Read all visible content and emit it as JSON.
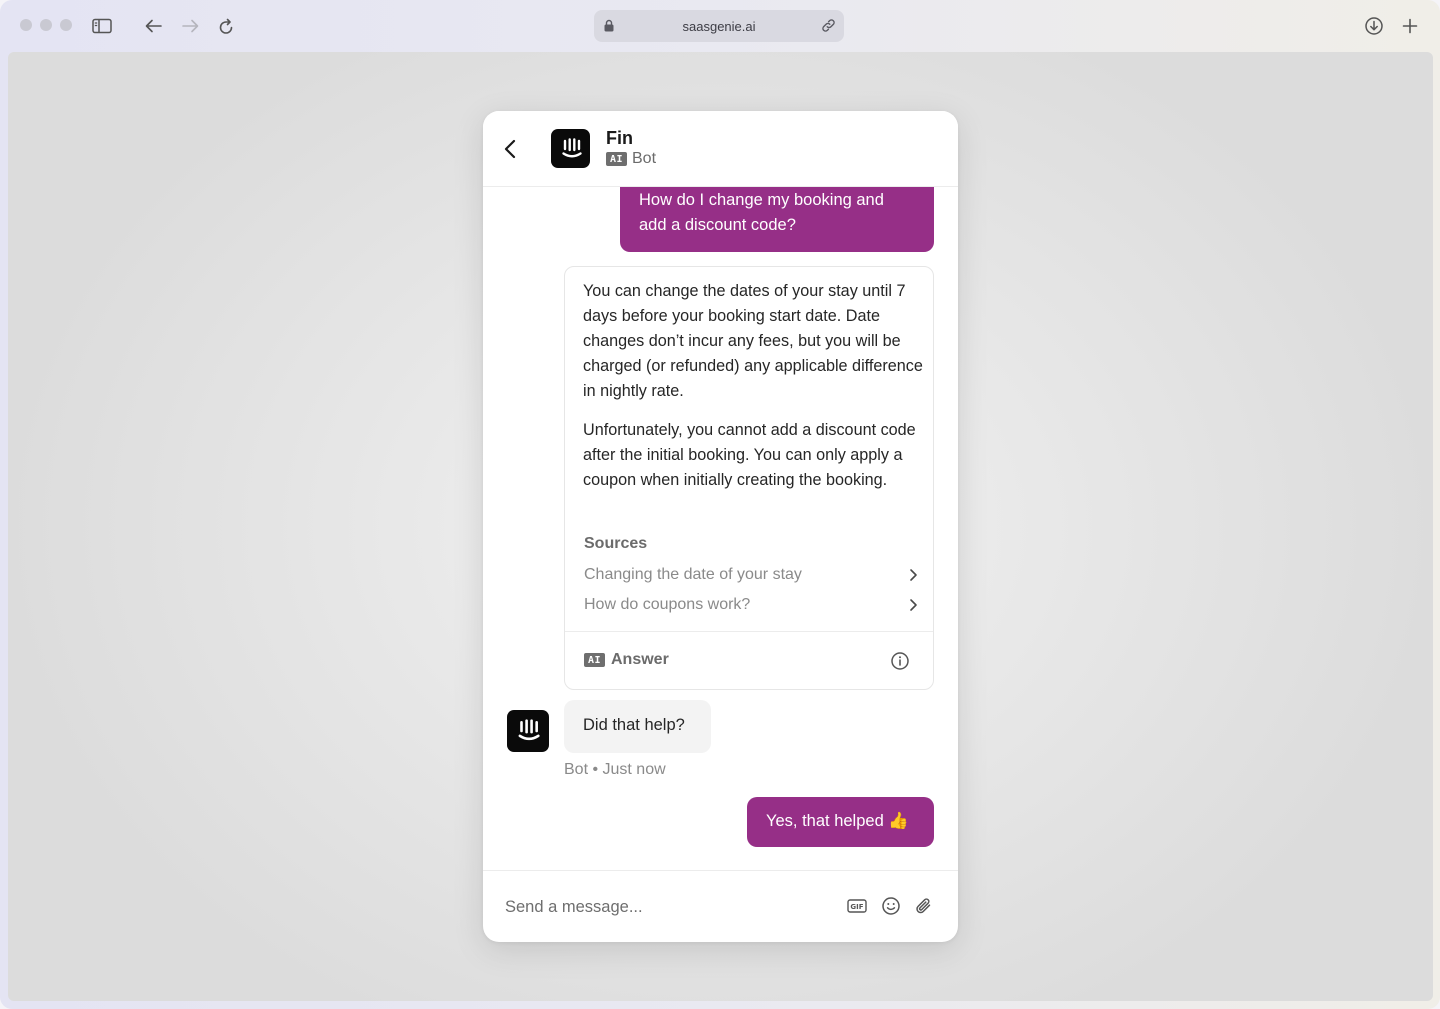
{
  "browser": {
    "url": "saasgenie.ai",
    "icons": [
      "sidebar-icon",
      "back-arrow-icon",
      "forward-arrow-icon",
      "reload-icon",
      "lock-icon",
      "link-icon",
      "download-icon",
      "new-tab-icon"
    ]
  },
  "chat": {
    "header": {
      "title": "Fin",
      "badge": "AI",
      "subtitle": "Bot"
    },
    "user_message_1": "How do I change my booking and add a discount code?",
    "answer": {
      "paragraph_1": "You can change the dates of your stay until 7 days before your booking start date. Date changes don’t incur any fees, but you will be charged (or refunded) any applicable difference in nightly rate.",
      "paragraph_2": "Unfortunately, you cannot add a discount code after the initial booking. You can only apply a coupon when initially creating the booking.",
      "sources_title": "Sources",
      "sources": [
        {
          "label": "Changing the date of your stay"
        },
        {
          "label": "How do coupons work?"
        }
      ],
      "footer_badge": "AI",
      "footer_label": "Answer"
    },
    "bot_message": "Did that help?",
    "bot_meta": "Bot • Just now",
    "user_message_2": "Yes, that helped 👍",
    "composer": {
      "placeholder": "Send a message...",
      "value": ""
    }
  },
  "colors": {
    "user_bubble": "#962f87",
    "avatar_bg": "#0a0a0a",
    "bot_bubble": "#f3f3f3"
  }
}
